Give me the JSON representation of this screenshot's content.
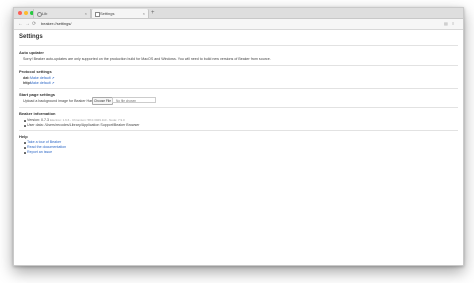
{
  "tabs": [
    {
      "label": "Lib",
      "close": "×"
    },
    {
      "label": "Settings",
      "close": "×"
    }
  ],
  "new_tab": "+",
  "nav": {
    "back": "←",
    "forward": "→",
    "reload": "⟳",
    "url": "beaker://settings/"
  },
  "page": {
    "title": "Settings",
    "auto_updater": {
      "heading": "Auto updater",
      "text": "Sorry! Beaker auto-updates are only supported on the production build for MacOS and Windows. You will need to build new versions of Beaker from source."
    },
    "protocol": {
      "heading": "Protocol settings",
      "rows": [
        {
          "name": "dat:",
          "link": "Make default ⇗"
        },
        {
          "name": "http:",
          "link": "Make default ⇗"
        }
      ]
    },
    "start_page": {
      "heading": "Start page settings",
      "label": "Upload a background image for Beaker Hash",
      "button": "Choose File",
      "file_value": "No file chosen"
    },
    "info": {
      "heading": "Beaker information",
      "version_label": "Version:",
      "version_value": "0.7.3",
      "version_detail": "Electron: 1.6.6 - Chromium: 58.0.3029.110 - Node: 7.9.0",
      "userdata_label": "User data:",
      "userdata_value": "/Users/recodes/Library/Application Support/Beaker Browser"
    },
    "help": {
      "heading": "Help",
      "links": [
        "Take a tour of Beaker",
        "Read the documentation",
        "Report an issue"
      ]
    }
  }
}
